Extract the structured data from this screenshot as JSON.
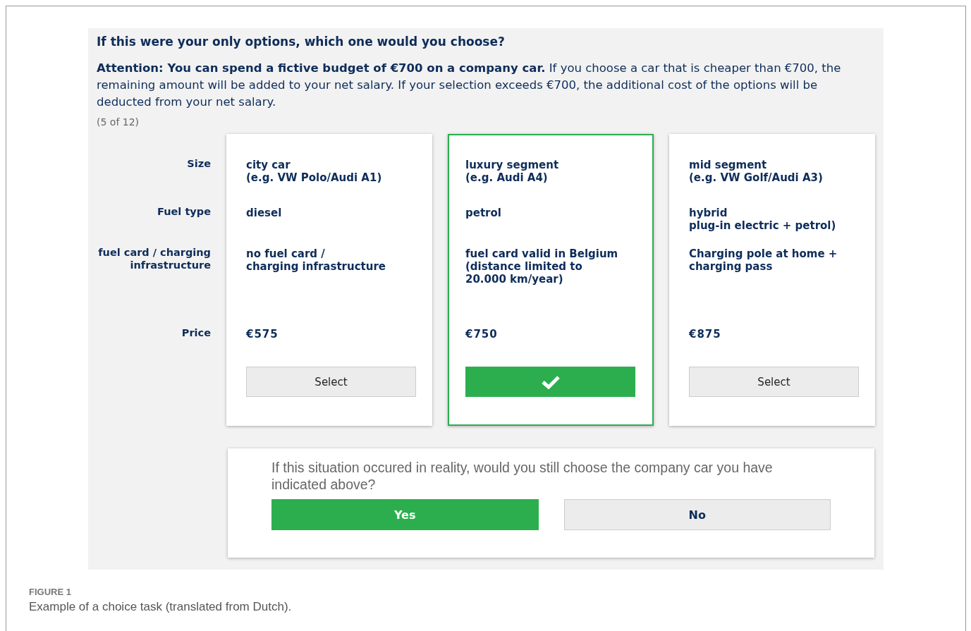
{
  "question": {
    "title": "If this were your only options, which one would you choose?",
    "text": "**Attention: You can spend a fictive budget of €700 on a company car.** If you choose a car that is cheaper than €700, the remaining amount will be added to your net salary. If your selection exceeds €700, the additional cost of the options will be deducted from your net salary.",
    "progress": "(5 of 12)"
  },
  "attributes": [
    "Size",
    "Fuel type",
    "fuel card / charging\ninfrastructure",
    "Price"
  ],
  "options": [
    {
      "values": [
        "city car\n(e.g. VW Polo/Audi A1)",
        "diesel",
        "no fuel card /\ncharging infrastructure"
      ],
      "price": "€575",
      "button": "Select",
      "selected": false
    },
    {
      "values": [
        "luxury segment\n(e.g. Audi A4)",
        "petrol",
        "fuel card valid in Belgium\n(distance limited to\n20.000 km/year)"
      ],
      "price": "€750",
      "selected": true
    },
    {
      "values": [
        "mid segment\n(e.g. VW Golf/Audi A3)",
        "hybrid\nplug-in electric + petrol)",
        "Charging pole at home +\ncharging pass"
      ],
      "price": "€875",
      "button": "Select",
      "selected": false
    }
  ],
  "followup": {
    "question": "If this situation occured in reality, would you still choose the company car you have indicated above?",
    "answers": [
      {
        "label": "Yes",
        "selected": true
      },
      {
        "label": "No",
        "selected": false
      }
    ]
  },
  "caption": {
    "label": "FIGURE 1",
    "text": "Example of a choice task (translated from Dutch)."
  }
}
